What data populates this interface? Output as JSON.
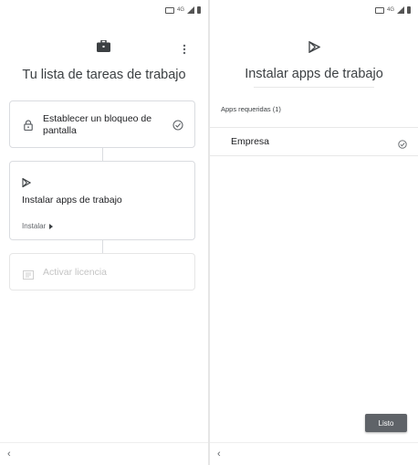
{
  "left": {
    "title": "Tu lista de tareas de trabajo",
    "tasks": [
      {
        "label": "Establecer un bloqueo de pantalla"
      },
      {
        "label": "Instalar apps de trabajo",
        "action": "Instalar"
      },
      {
        "label": "Activar licencia"
      }
    ]
  },
  "right": {
    "title": "Instalar apps de trabajo",
    "section_header": "Apps requeridas (1)",
    "apps": [
      {
        "name": "Empresa"
      }
    ],
    "done_button": "Listo"
  },
  "nav": {
    "back_glyph": "‹"
  },
  "colors": {
    "text_primary": "#202124",
    "text_secondary": "#5f6368",
    "disabled": "#c4c4c4",
    "border": "#dadce0",
    "button_bg": "#5f6368"
  },
  "icons": [
    "briefcase-icon",
    "more-vert-icon",
    "lock-icon",
    "check-circle-icon",
    "play-store-icon",
    "arrow-right-icon",
    "license-icon",
    "back-arrow-icon",
    "battery-icon",
    "signal-icon"
  ]
}
